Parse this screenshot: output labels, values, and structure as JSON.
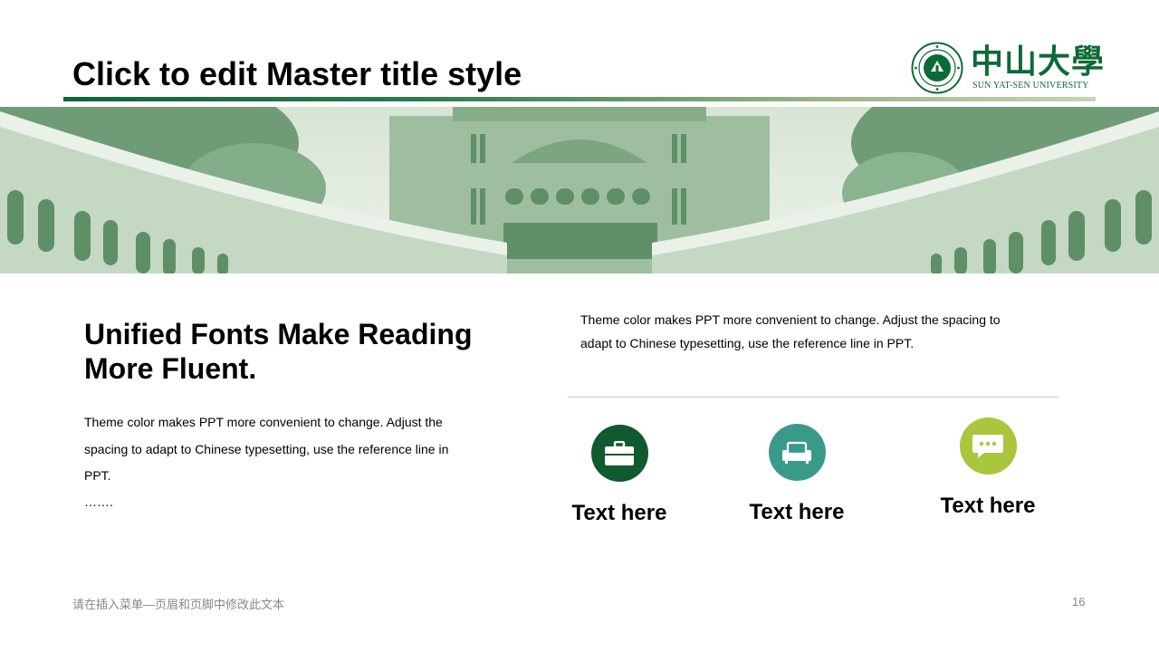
{
  "slide": {
    "master_title": "Click to edit Master title style",
    "page_number": "16",
    "footer_text": "请在插入菜单—页眉和页脚中修改此文本"
  },
  "logo": {
    "chinese_name": "中山大學",
    "english_name": "SUN YAT-SEN UNIVERSITY",
    "seal_text": "SUN YAT-SEN UNIVERSITY"
  },
  "left": {
    "heading": "Unified Fonts Make Reading More Fluent.",
    "body": "Theme color makes PPT more convenient to change. Adjust the spacing to adapt to Chinese typesetting, use the reference line in PPT.",
    "ellipsis": "……."
  },
  "right": {
    "body": "Theme color makes PPT more convenient to change. Adjust the spacing to adapt to Chinese typesetting, use the reference line in PPT."
  },
  "features": [
    {
      "label": "Text here",
      "icon": "briefcase-icon",
      "color": "#0f5a2e"
    },
    {
      "label": "Text here",
      "icon": "sofa-icon",
      "color": "#3a9a8a"
    },
    {
      "label": "Text here",
      "icon": "chat-bubble-icon",
      "color": "#a9c63c"
    }
  ],
  "colors": {
    "theme_green": "#0d6a35",
    "banner_tint": "#7fa986",
    "footer_gray": "#888888"
  }
}
